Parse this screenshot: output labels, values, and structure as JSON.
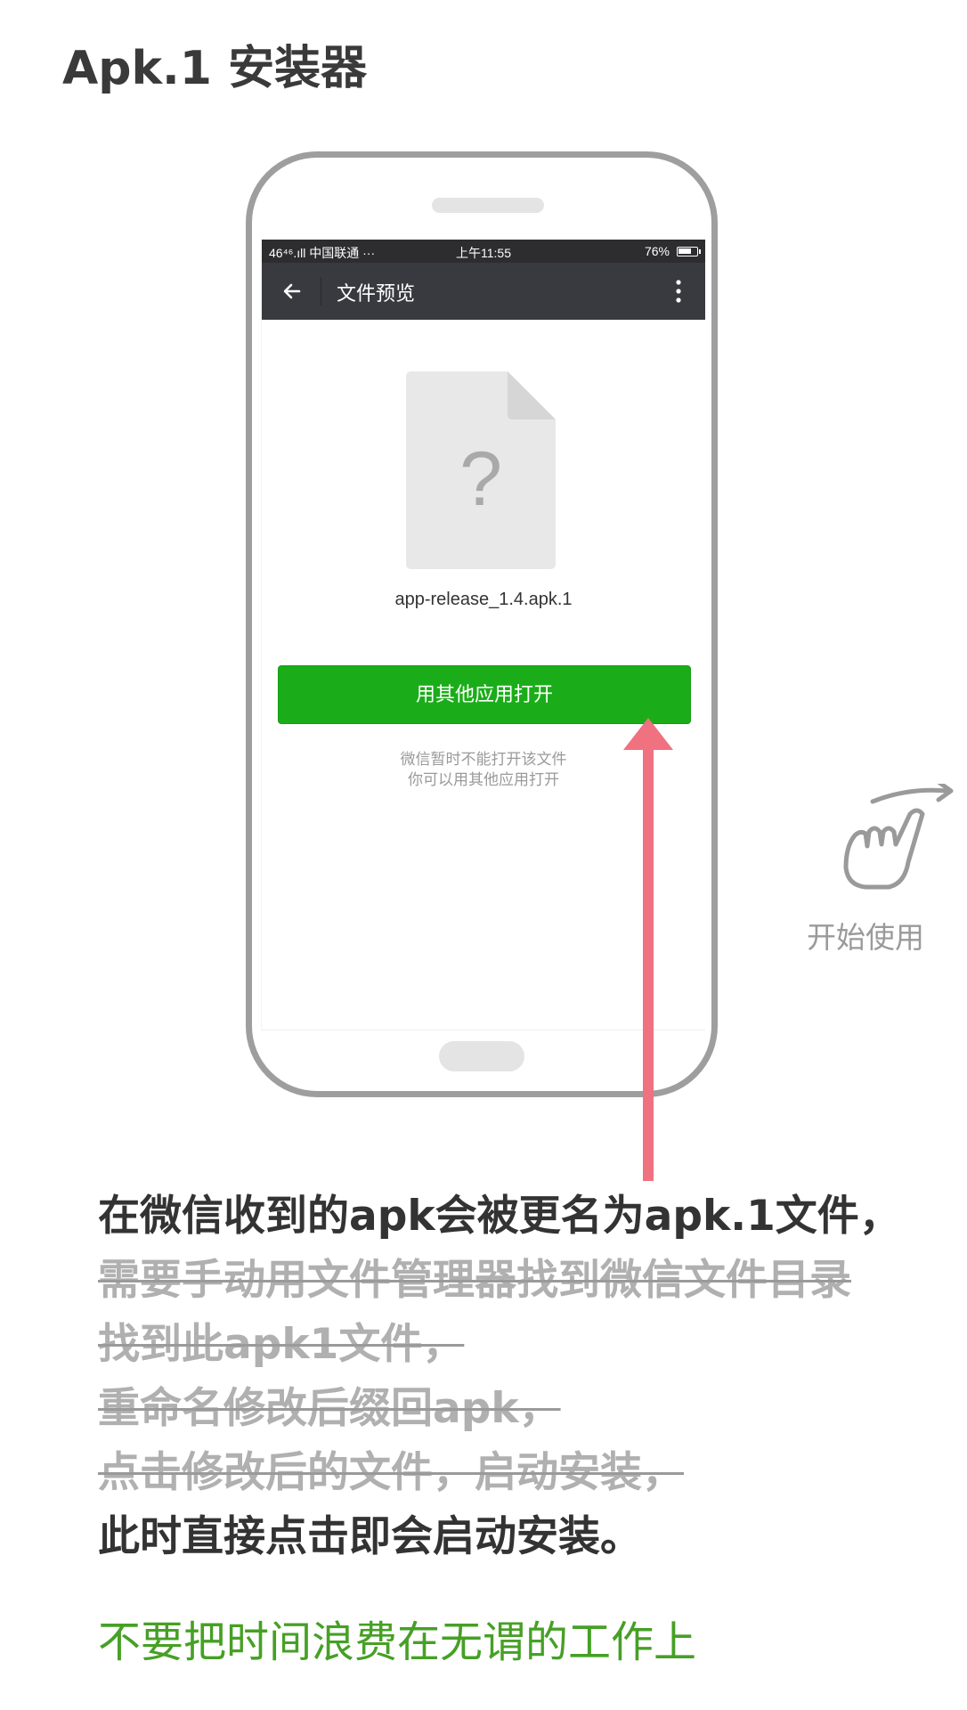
{
  "page_title": "Apk.1 安装器",
  "phone": {
    "status_bar": {
      "signal": "46⁴⁶.ıll",
      "carrier": "中国联通 ···",
      "time": "上午11:55",
      "battery_percent": "76%",
      "battery_level": 0.76
    },
    "app_bar": {
      "title": "文件预览",
      "back_icon": "back-arrow-icon",
      "more_icon": "more-vertical-icon"
    },
    "file": {
      "icon": "unknown-file-icon",
      "icon_glyph": "?",
      "name": "app-release_1.4.apk.1"
    },
    "open_button_label": "用其他应用打开",
    "hint_lines": [
      "微信暂时不能打开该文件",
      "你可以用其他应用打开"
    ]
  },
  "gesture": {
    "icon": "swipe-hand-icon",
    "label": "开始使用"
  },
  "caption": {
    "line1": "在微信收到的apk会被更名为apk.1文件，",
    "struck_lines": [
      "需要手动用文件管理器找到微信文件目录",
      "找到此apk1文件，",
      "重命名修改后缀回apk，",
      "点击修改后的文件，启动安装，"
    ],
    "last_line": "此时直接点击即会启动安装。"
  },
  "slogan": "不要把时间浪费在无谓的工作上",
  "colors": {
    "button_green": "#1aad19",
    "arrow_pink": "#f0717f",
    "slogan_green": "#46a025",
    "app_bar": "#393a3f"
  }
}
